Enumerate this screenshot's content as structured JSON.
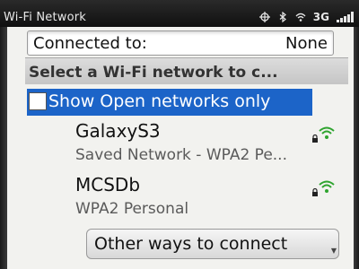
{
  "status_bar": {
    "title": "Wi-Fi Network",
    "network_type": "3G",
    "icons": [
      "location-icon",
      "bluetooth-icon",
      "wifi-icon",
      "network-type",
      "signal-icon"
    ]
  },
  "connected": {
    "label": "Connected to:",
    "value": "None"
  },
  "section_header": "Select a Wi-Fi network to c...",
  "show_open": {
    "label": "Show Open networks only",
    "checked": false
  },
  "networks": [
    {
      "name": "GalaxyS3",
      "detail": "Saved Network - WPA2 Pe...",
      "locked": true,
      "signal_icon": "wifi-icon"
    },
    {
      "name": "MCSDb",
      "detail": "WPA2 Personal",
      "locked": true,
      "signal_icon": "wifi-icon"
    }
  ],
  "other_ways_button": "Other ways to connect",
  "colors": {
    "highlight": "#1c64c8",
    "wifi_green": "#2ea42e",
    "background": "#f2f2ef"
  }
}
